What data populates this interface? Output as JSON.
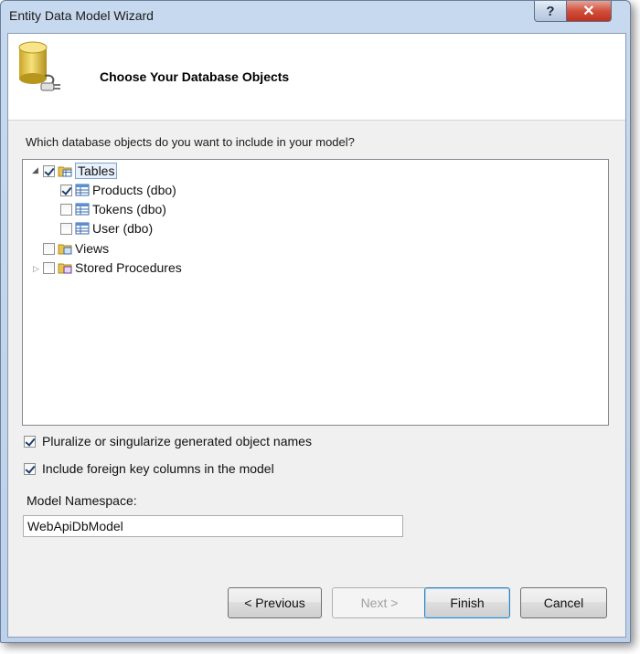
{
  "window": {
    "title": "Entity Data Model Wizard",
    "help_glyph": "?",
    "close_glyph": "✕"
  },
  "header": {
    "title": "Choose Your Database Objects",
    "icon": "database-connection-icon"
  },
  "prompt": "Which database objects do you want to include in your model?",
  "tree": {
    "tables": {
      "label": "Tables",
      "checked": true,
      "expanded": true,
      "icon": "tables-folder-icon"
    },
    "children": [
      {
        "label": "Products (dbo)",
        "checked": true,
        "icon": "table-icon"
      },
      {
        "label": "Tokens (dbo)",
        "checked": false,
        "icon": "table-icon"
      },
      {
        "label": "User (dbo)",
        "checked": false,
        "icon": "table-icon"
      }
    ],
    "views": {
      "label": "Views",
      "checked": false,
      "icon": "views-folder-icon"
    },
    "stored_procedures": {
      "label": "Stored Procedures",
      "checked": false,
      "expanded": false,
      "icon": "procedures-folder-icon"
    }
  },
  "options": {
    "pluralize": {
      "label": "Pluralize or singularize generated object names",
      "checked": true
    },
    "foreign_keys": {
      "label": "Include foreign key columns in the model",
      "checked": true
    }
  },
  "namespace": {
    "label": "Model Namespace:",
    "value": "WebApiDbModel"
  },
  "buttons": {
    "previous": "< Previous",
    "next": "Next >",
    "finish": "Finish",
    "cancel": "Cancel"
  },
  "colors": {
    "title_bar": "#c7d9ee",
    "close_button": "#c2301c",
    "selection_border": "#7da2ce"
  }
}
